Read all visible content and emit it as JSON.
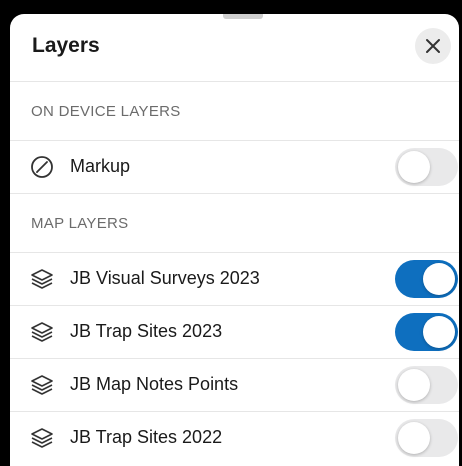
{
  "header": {
    "title": "Layers",
    "close_icon": "close-icon"
  },
  "sections": {
    "on_device": {
      "label": "ON DEVICE LAYERS",
      "items": [
        {
          "label": "Markup",
          "icon": "markup-icon",
          "enabled": false
        }
      ]
    },
    "map_layers": {
      "label": "MAP LAYERS",
      "items": [
        {
          "label": "JB Visual Surveys 2023",
          "icon": "layers-icon",
          "enabled": true
        },
        {
          "label": "JB Trap Sites 2023",
          "icon": "layers-icon",
          "enabled": true
        },
        {
          "label": "JB Map Notes Points",
          "icon": "layers-icon",
          "enabled": false
        },
        {
          "label": "JB Trap Sites 2022",
          "icon": "layers-icon",
          "enabled": false
        }
      ]
    }
  },
  "colors": {
    "toggle_on": "#0e6fbf",
    "toggle_off": "#e9e9ea"
  }
}
